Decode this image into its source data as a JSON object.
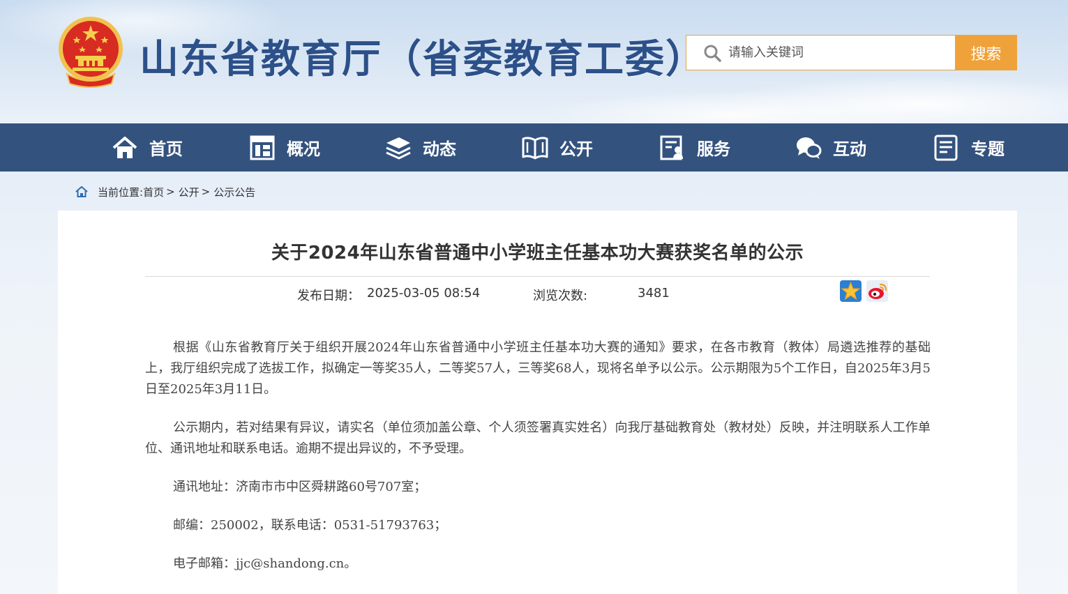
{
  "header": {
    "site_title": "山东省教育厅（省委教育工委）",
    "search_placeholder": "请输入关键词",
    "search_button": "搜索"
  },
  "nav": {
    "items": [
      {
        "label": "首页",
        "icon": "home-icon"
      },
      {
        "label": "概况",
        "icon": "building-icon"
      },
      {
        "label": "动态",
        "icon": "layers-icon"
      },
      {
        "label": "公开",
        "icon": "open-book-icon"
      },
      {
        "label": "服务",
        "icon": "service-document-icon"
      },
      {
        "label": "互动",
        "icon": "chat-icon"
      },
      {
        "label": "专题",
        "icon": "topic-document-icon"
      }
    ]
  },
  "breadcrumb": {
    "prefix": "当前位置:",
    "items": [
      "首页",
      "公开",
      "公示公告"
    ],
    "separator": ">"
  },
  "article": {
    "title": "关于2024年山东省普通中小学班主任基本功大赛获奖名单的公示",
    "publish_label": "发布日期：",
    "publish_date": "2025-03-05 08:54",
    "views_label": "浏览次数:",
    "views": "3481",
    "paragraphs": [
      "根据《山东省教育厅关于组织开展2024年山东省普通中小学班主任基本功大赛的通知》要求，在各市教育（教体）局遴选推荐的基础上，我厅组织完成了选拔工作，拟确定一等奖35人，二等奖57人，三等奖68人，现将名单予以公示。公示期限为5个工作日，自2025年3月5日至2025年3月11日。",
      "公示期内，若对结果有异议，请实名（单位须加盖公章、个人须签署真实姓名）向我厅基础教育处（教材处）反映，并注明联系人工作单位、通讯地址和联系电话。逾期不提出异议的，不予受理。",
      "通讯地址：济南市市中区舜耕路60号707室；",
      "邮编：250002，联系电话：0531-51793763；",
      "电子邮箱：jjc@shandong.cn。"
    ]
  },
  "colors": {
    "nav_bg": "#33527e",
    "title_blue": "#2c5089",
    "search_orange": "#f0a23a"
  }
}
